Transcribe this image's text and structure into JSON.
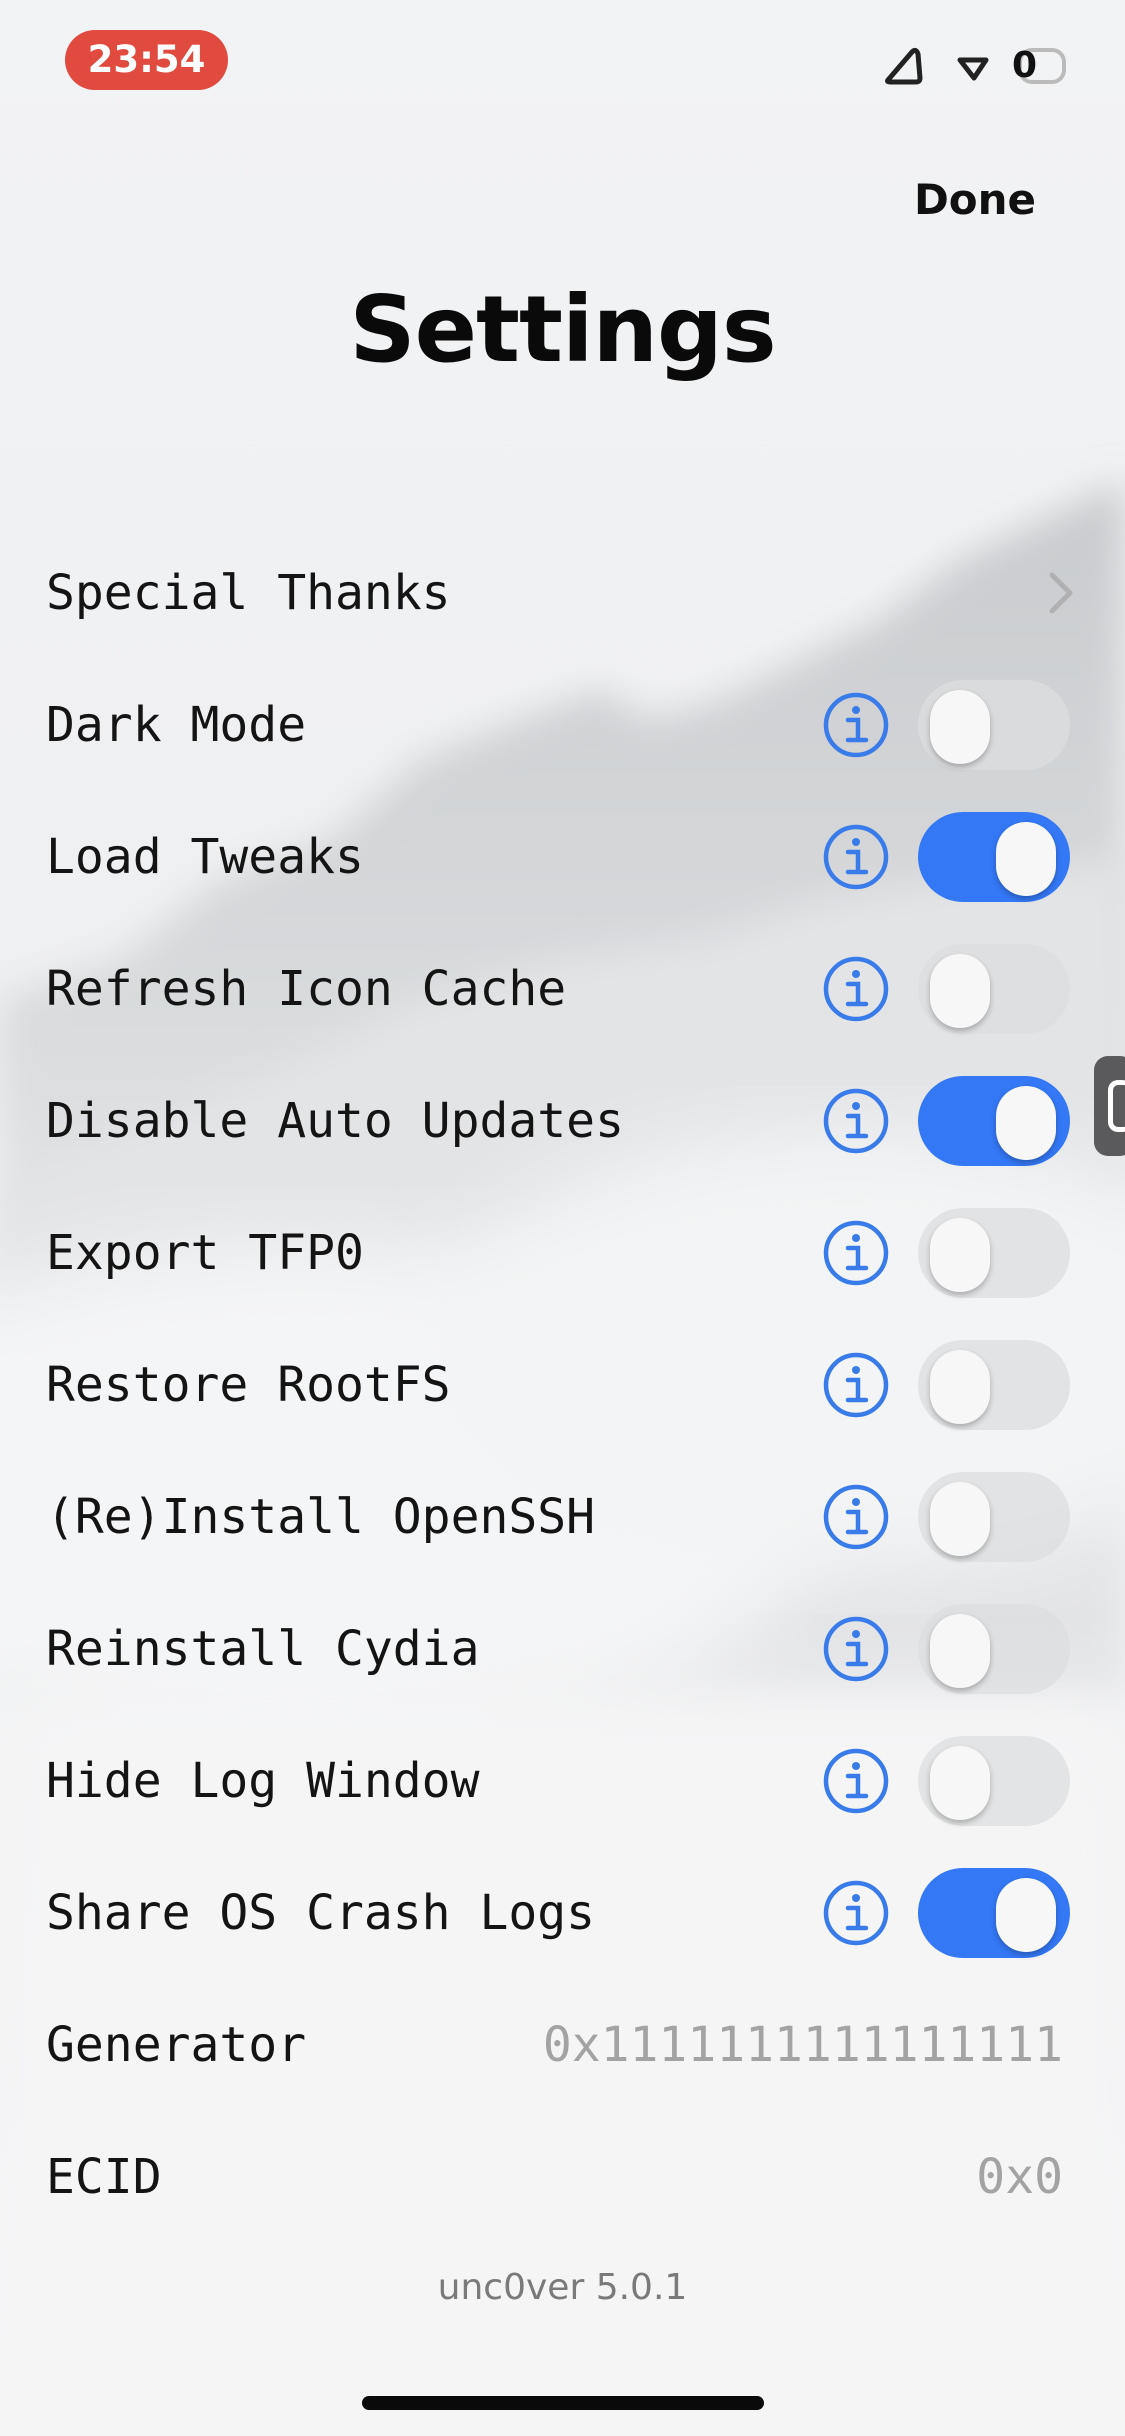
{
  "status_bar": {
    "time": "23:54",
    "battery_text": "0",
    "icons": [
      "cellular-icon",
      "wifi-icon",
      "battery-icon"
    ],
    "time_pill_color": "#e04a3f"
  },
  "header": {
    "done_label": "Done",
    "title": "Settings"
  },
  "colors": {
    "accent": "#3478f6",
    "toggle_off": "#dcdddf",
    "value_text": "#a3a3a3"
  },
  "settings": {
    "special_thanks": {
      "label": "Special Thanks",
      "icon": "chevron-right-icon"
    },
    "dark_mode": {
      "label": "Dark Mode",
      "enabled": false
    },
    "load_tweaks": {
      "label": "Load Tweaks",
      "enabled": true
    },
    "refresh_icon_cache": {
      "label": "Refresh Icon Cache",
      "enabled": false
    },
    "disable_auto_updates": {
      "label": "Disable Auto Updates",
      "enabled": true
    },
    "export_tfp0": {
      "label": "Export TFP0",
      "enabled": false
    },
    "restore_rootfs": {
      "label": "Restore RootFS",
      "enabled": false
    },
    "reinstall_openssh": {
      "label": "(Re)Install OpenSSH",
      "enabled": false
    },
    "reinstall_cydia": {
      "label": "Reinstall Cydia",
      "enabled": false
    },
    "hide_log_window": {
      "label": "Hide Log Window",
      "enabled": false
    },
    "share_os_crash_logs": {
      "label": "Share OS Crash Logs",
      "enabled": true
    },
    "generator": {
      "label": "Generator",
      "value": "0x1111111111111111"
    },
    "ecid": {
      "label": "ECID",
      "value": "0x0"
    }
  },
  "footer": {
    "version": "unc0ver 5.0.1"
  }
}
